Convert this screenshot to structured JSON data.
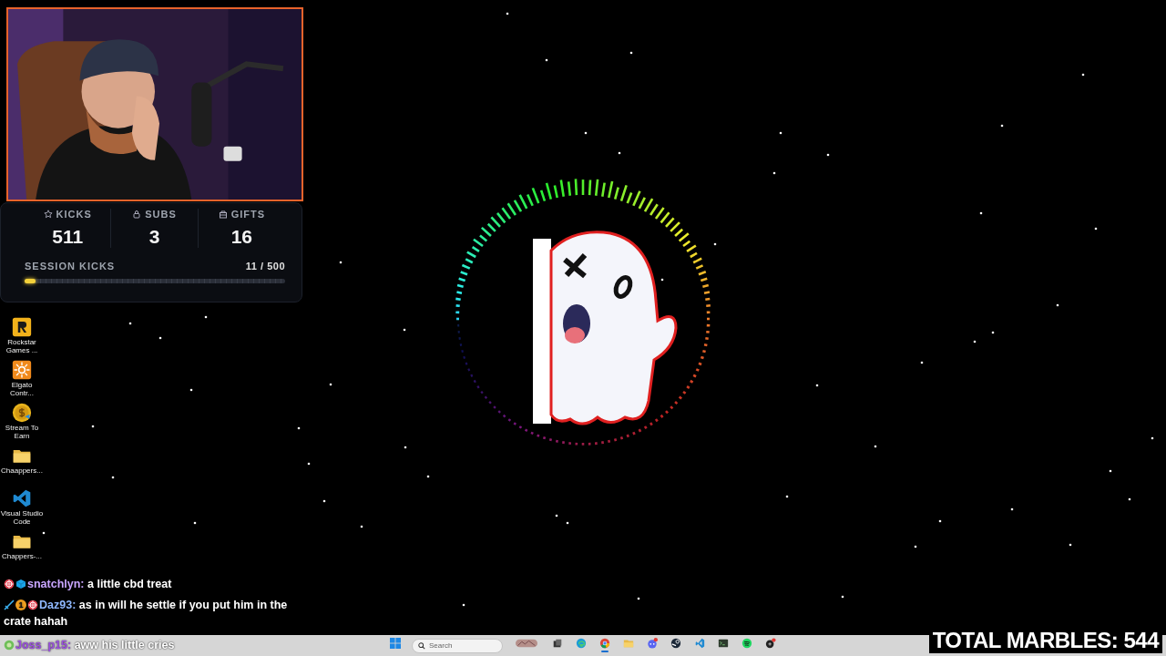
{
  "stats": [
    {
      "kind": "star",
      "label": "KICKS",
      "value": "511"
    },
    {
      "kind": "sub",
      "label": "SUBS",
      "value": "3"
    },
    {
      "kind": "gift",
      "label": "GIFTS",
      "value": "16"
    }
  ],
  "session": {
    "label": "SESSION KICKS",
    "reading": "11 / 500",
    "level": 0.022
  },
  "desktop_icons": [
    {
      "kind": "rockstar",
      "label": "Rockstar Games ..."
    },
    {
      "kind": "elgato",
      "label": "Elgato Contr..."
    },
    {
      "kind": "coin",
      "label": "Stream To Earn"
    },
    {
      "kind": "folder",
      "label": "Chaappers..."
    },
    {
      "kind": "vscode",
      "label": "Visual Studio Code"
    },
    {
      "kind": "folder",
      "label": "Chappers-..."
    }
  ],
  "chat": [
    {
      "badges": [
        {
          "kind": "pride"
        },
        {
          "kind": "cube"
        }
      ],
      "user": "snatchlyn:",
      "color": "#c9a6ff",
      "message": "a little cbd treat"
    },
    {
      "badges": [
        {
          "kind": "sword"
        },
        {
          "kind": "number",
          "text": "1"
        },
        {
          "kind": "pride"
        }
      ],
      "user": "Daz93:",
      "color": "#8fb8ff",
      "message": "as in will he settle if you put him in the crate hahah"
    },
    {
      "badges": [
        {
          "kind": "leaf"
        }
      ],
      "user": "Joss_p15:",
      "color": "#9b4fe0",
      "message": "aww his little cries"
    }
  ],
  "taskbar": {
    "search": {
      "placeholder": "Search"
    },
    "apps": [
      {
        "kind": "windows",
        "selected": false
      },
      {
        "kind": "widget",
        "selected": false
      },
      {
        "kind": "taskview",
        "selected": false
      },
      {
        "kind": "edge",
        "selected": false
      },
      {
        "kind": "chrome",
        "selected": true
      },
      {
        "kind": "folder",
        "selected": false
      },
      {
        "kind": "discord",
        "selected": false
      },
      {
        "kind": "steam",
        "selected": false
      },
      {
        "kind": "vscode",
        "selected": false
      },
      {
        "kind": "terminal",
        "selected": false
      },
      {
        "kind": "spotify",
        "selected": false
      },
      {
        "kind": "app",
        "selected": false
      }
    ]
  },
  "marbles": {
    "text": "TOTAL MARBLES: 544"
  }
}
